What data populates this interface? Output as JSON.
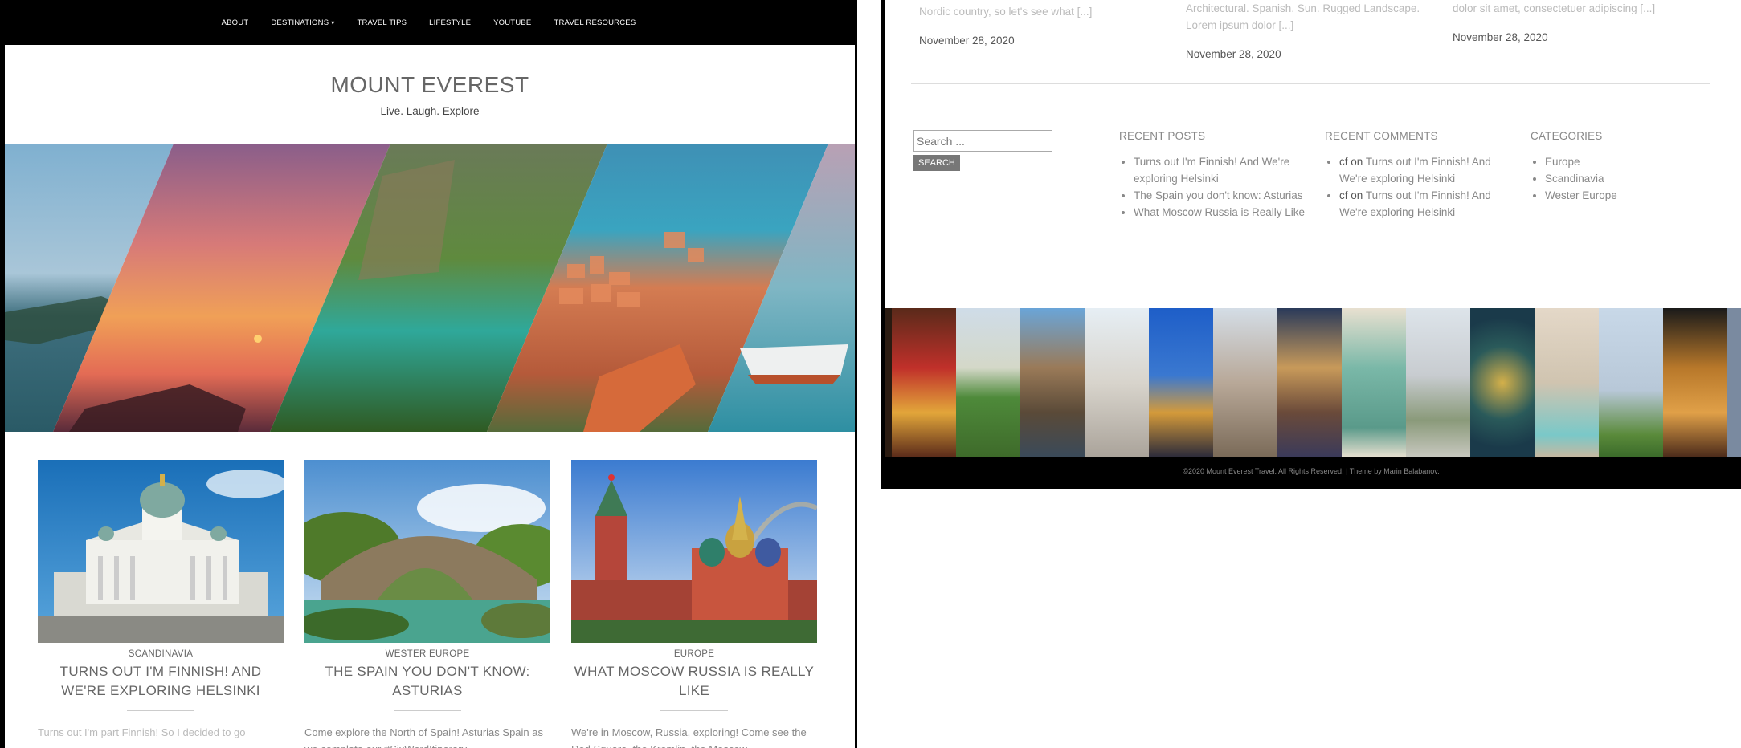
{
  "nav": {
    "items": [
      {
        "label": "ABOUT"
      },
      {
        "label": "DESTINATIONS",
        "has_dropdown": true
      },
      {
        "label": "TRAVEL TIPS"
      },
      {
        "label": "LIFESTYLE"
      },
      {
        "label": "YOUTUBE"
      },
      {
        "label": "TRAVEL RESOURCES"
      }
    ],
    "caret": "▾"
  },
  "site": {
    "title": "MOUNT EVEREST",
    "tagline": "Live. Laugh. Explore"
  },
  "posts": [
    {
      "category": "SCANDINAVIA",
      "title": "TURNS OUT I'M FINNISH! AND WE'RE EXPLORING HELSINKI",
      "excerpt": "Turns out I'm part Finnish! So I decided to go",
      "image": "helsinki-cathedral"
    },
    {
      "category": "WESTER EUROPE",
      "title": "THE SPAIN YOU DON'T KNOW: ASTURIAS",
      "excerpt": "Come explore the North of Spain! Asturias Spain as we complete our #SixWordItinerary",
      "image": "asturias-bridge"
    },
    {
      "category": "EUROPE",
      "title": "WHAT MOSCOW RUSSIA IS REALLY LIKE",
      "excerpt": "We're in Moscow, Russia, exploring! Come see the Red Square, the Kremlin, the Moscow",
      "image": "moscow-red-square"
    }
  ],
  "right": {
    "top_posts": [
      {
        "excerpt": "Nordic country, so let's see what [...]",
        "date": "November 28, 2020"
      },
      {
        "excerpt": "Architectural. Spanish. Sun. Rugged Landscape. Lorem ipsum dolor [...]",
        "date": "November 28, 2020"
      },
      {
        "excerpt": "dolor sit amet, consectetuer adipiscing [...]",
        "date": "November 28, 2020"
      }
    ],
    "search": {
      "placeholder": "Search ...",
      "button": "SEARCH"
    },
    "recent_posts": {
      "title": "RECENT POSTS",
      "items": [
        "Turns out I'm Finnish! And We're exploring Helsinki",
        "The Spain you don't know: Asturias",
        "What Moscow Russia is Really Like"
      ]
    },
    "recent_comments": {
      "title": "RECENT COMMENTS",
      "items": [
        {
          "author": "cf",
          "on": "on",
          "post": "Turns out I'm Finnish! And We're exploring Helsinki"
        },
        {
          "author": "cf",
          "on": "on",
          "post": "Turns out I'm Finnish! And We're exploring Helsinki"
        }
      ]
    },
    "categories": {
      "title": "CATEGORIES",
      "items": [
        "Europe",
        "Scandinavia",
        "Wester Europe"
      ]
    },
    "footer": "©2020 Mount Everest Travel. All Rights Reserved. | Theme by Marin Balabanov."
  },
  "colors": {
    "nav_bg": "#000000",
    "text": "#555555",
    "muted": "#888888",
    "button": "#777777"
  }
}
